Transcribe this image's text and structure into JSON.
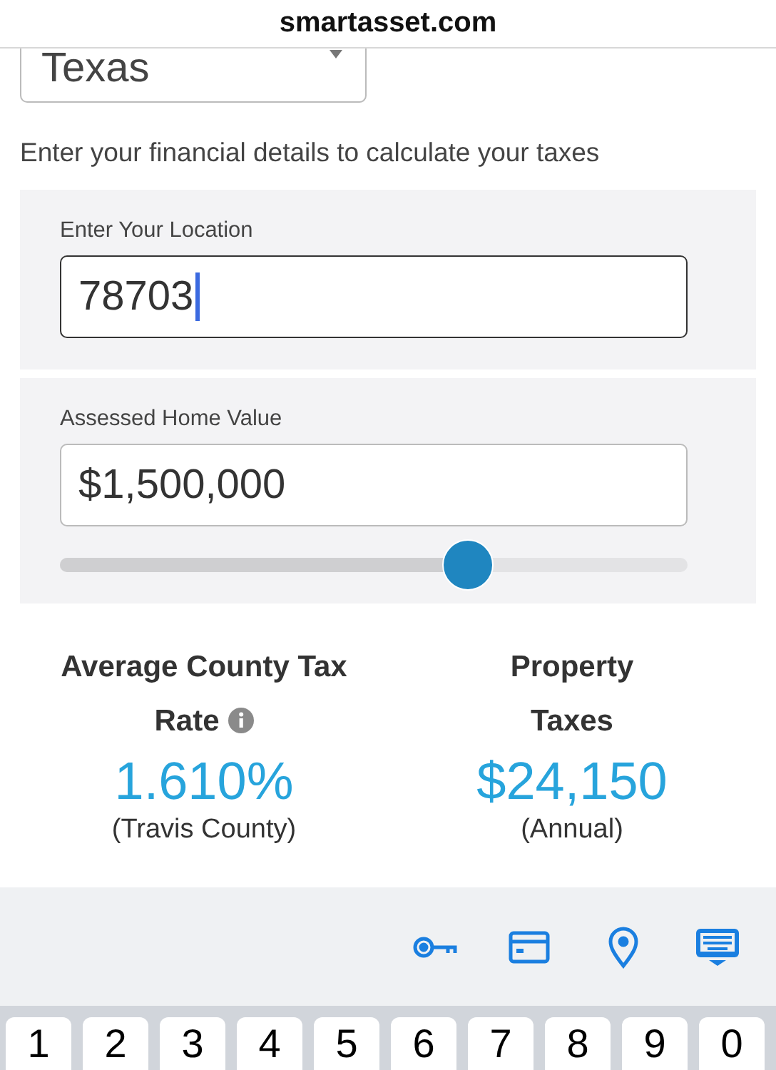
{
  "address_bar": {
    "url": "smartasset.com"
  },
  "state_select": {
    "value": "Texas"
  },
  "intro": "Enter your financial details to calculate your taxes",
  "location": {
    "label": "Enter Your Location",
    "value": "78703",
    "focused": true
  },
  "home_value": {
    "label": "Assessed Home Value",
    "value": "$1,500,000",
    "level": 0.65
  },
  "results": [
    {
      "title": "Average County Tax Rate",
      "info": true,
      "value": "1.610%",
      "note": "(Travis County)"
    },
    {
      "title": "Property Taxes",
      "info": false,
      "value": "$24,150",
      "note": "(Annual)"
    }
  ],
  "keyboard_toolbar": [
    {
      "kind": "key"
    },
    {
      "kind": "card"
    },
    {
      "kind": "location"
    },
    {
      "kind": "keyboard"
    }
  ],
  "keys": [
    "1",
    "2",
    "3",
    "4",
    "5",
    "6",
    "7",
    "8",
    "9",
    "0"
  ]
}
